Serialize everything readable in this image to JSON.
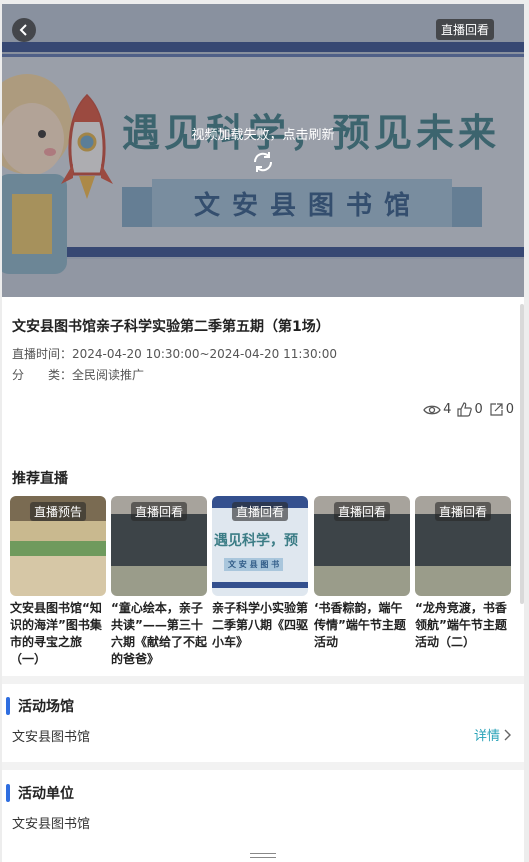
{
  "video": {
    "banner_title": "遇见科学，预见未来",
    "banner_sub": "文安县图书馆",
    "replay_tag": "直播回看",
    "error_text": "视频加载失败，点击刷新"
  },
  "info": {
    "title": "文安县图书馆亲子科学实验第二季第五期（第1场）",
    "time_label": "直播时间：",
    "time_value": "2024-04-20 10:30:00~2024-04-20 11:30:00",
    "category_label": "分　　类：",
    "category_value": "全民阅读推广",
    "views": "4",
    "likes": "0",
    "shares": "0"
  },
  "recommend": {
    "heading": "推荐直播",
    "cards": [
      {
        "tag": "直播预告",
        "title": "文安县图书馆“知识的海洋”图书集市的寻宝之旅（一）"
      },
      {
        "tag": "直播回看",
        "title": "“童心绘本，亲子共读”——第三十六期《献给了不起的爸爸》"
      },
      {
        "tag": "直播回看",
        "title": "亲子科学小实验第二季第八期《四驱小车》",
        "thumb_text": "遇见科学，预",
        "thumb_sub": "文 安 县 图 书"
      },
      {
        "tag": "直播回看",
        "title": "‘书香粽韵，端午传情”端午节主题活动"
      },
      {
        "tag": "直播回看",
        "title": "“龙舟竞渡，书香领航”端午节主题活动（二）"
      }
    ]
  },
  "venue": {
    "heading": "活动场馆",
    "value": "文安县图书馆",
    "detail": "详情"
  },
  "unit": {
    "heading": "活动单位",
    "value": "文安县图书馆"
  }
}
